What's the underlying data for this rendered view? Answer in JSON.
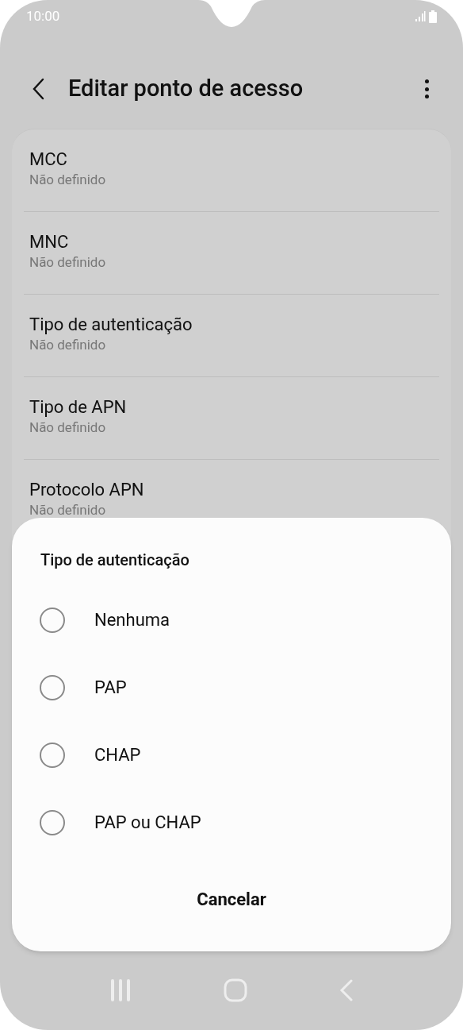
{
  "status_bar": {
    "time": "10:00"
  },
  "header": {
    "title": "Editar ponto de acesso"
  },
  "settings": [
    {
      "title": "MCC",
      "value": "Não definido"
    },
    {
      "title": "MNC",
      "value": "Não definido"
    },
    {
      "title": "Tipo de autenticação",
      "value": "Não definido"
    },
    {
      "title": "Tipo de APN",
      "value": "Não definido"
    },
    {
      "title": "Protocolo APN",
      "value": "Não definido"
    }
  ],
  "dialog": {
    "title": "Tipo de autenticação",
    "options": [
      {
        "label": "Nenhuma",
        "selected": false
      },
      {
        "label": "PAP",
        "selected": false
      },
      {
        "label": "CHAP",
        "selected": false
      },
      {
        "label": "PAP ou CHAP",
        "selected": false
      }
    ],
    "cancel": "Cancelar"
  }
}
